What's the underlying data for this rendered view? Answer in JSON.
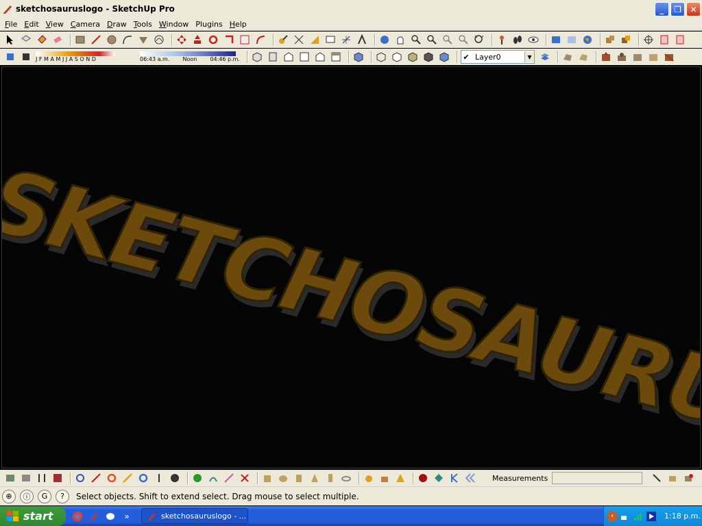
{
  "window": {
    "title": "sketchosauruslogo - SketchUp Pro",
    "buttons": {
      "minimize": "_",
      "maximize": "❐",
      "close": "✕"
    }
  },
  "menu": [
    {
      "label": "File",
      "underline": "F",
      "rest": "ile"
    },
    {
      "label": "Edit",
      "underline": "E",
      "rest": "dit"
    },
    {
      "label": "View",
      "underline": "V",
      "rest": "iew"
    },
    {
      "label": "Camera",
      "underline": "C",
      "rest": "amera"
    },
    {
      "label": "Draw",
      "underline": "D",
      "rest": "raw"
    },
    {
      "label": "Tools",
      "underline": "T",
      "rest": "ools"
    },
    {
      "label": "Window",
      "underline": "W",
      "rest": "indow"
    },
    {
      "label": "Plugins",
      "underline": "",
      "rest": "Plugins"
    },
    {
      "label": "Help",
      "underline": "H",
      "rest": "elp"
    }
  ],
  "shadow": {
    "months": "J F M A M J J A S O N D",
    "time_start": "06:43 a.m.",
    "time_noon": "Noon",
    "time_end": "04:46 p.m."
  },
  "layer": {
    "checked": "✔",
    "name": "Layer0"
  },
  "viewport": {
    "model_text": "SKETCHOSAURUS",
    "background": "#050505",
    "text_color": "#6b4a0c",
    "shadow_color": "#2a2a2a"
  },
  "bottom": {
    "measurements_label": "Measurements",
    "measurements_value": ""
  },
  "status": {
    "text": "Select objects. Shift to extend select. Drag mouse to select multiple."
  },
  "taskbar": {
    "start_label": "start",
    "more": "»",
    "task_label": "sketchosauruslogo - ...",
    "clock": "1:18 p.m."
  }
}
